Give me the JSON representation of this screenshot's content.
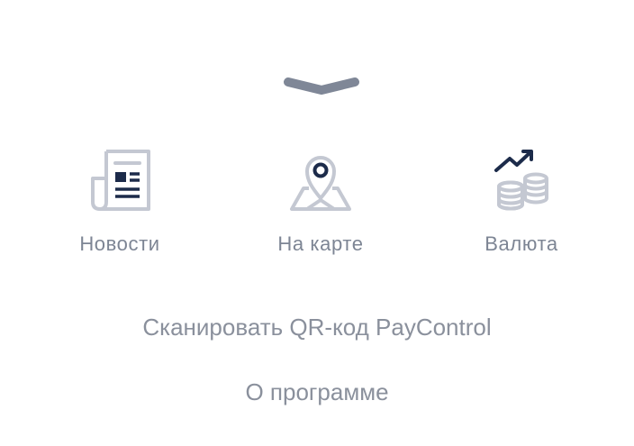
{
  "sheet": {
    "handle_icon": "chevron-down-icon"
  },
  "quick_actions": [
    {
      "label": "Новости",
      "icon": "newspaper-icon"
    },
    {
      "label": "На карте",
      "icon": "map-pin-icon"
    },
    {
      "label": "Валюта",
      "icon": "currency-growth-icon"
    }
  ],
  "menu": {
    "scan_qr": "Сканировать QR-код PayControl",
    "about": "О программе"
  },
  "colors": {
    "icon_outline": "#c4c8d2",
    "icon_accent": "#1c2b4a",
    "label_text": "#7d8594",
    "handle": "#7f8797"
  }
}
